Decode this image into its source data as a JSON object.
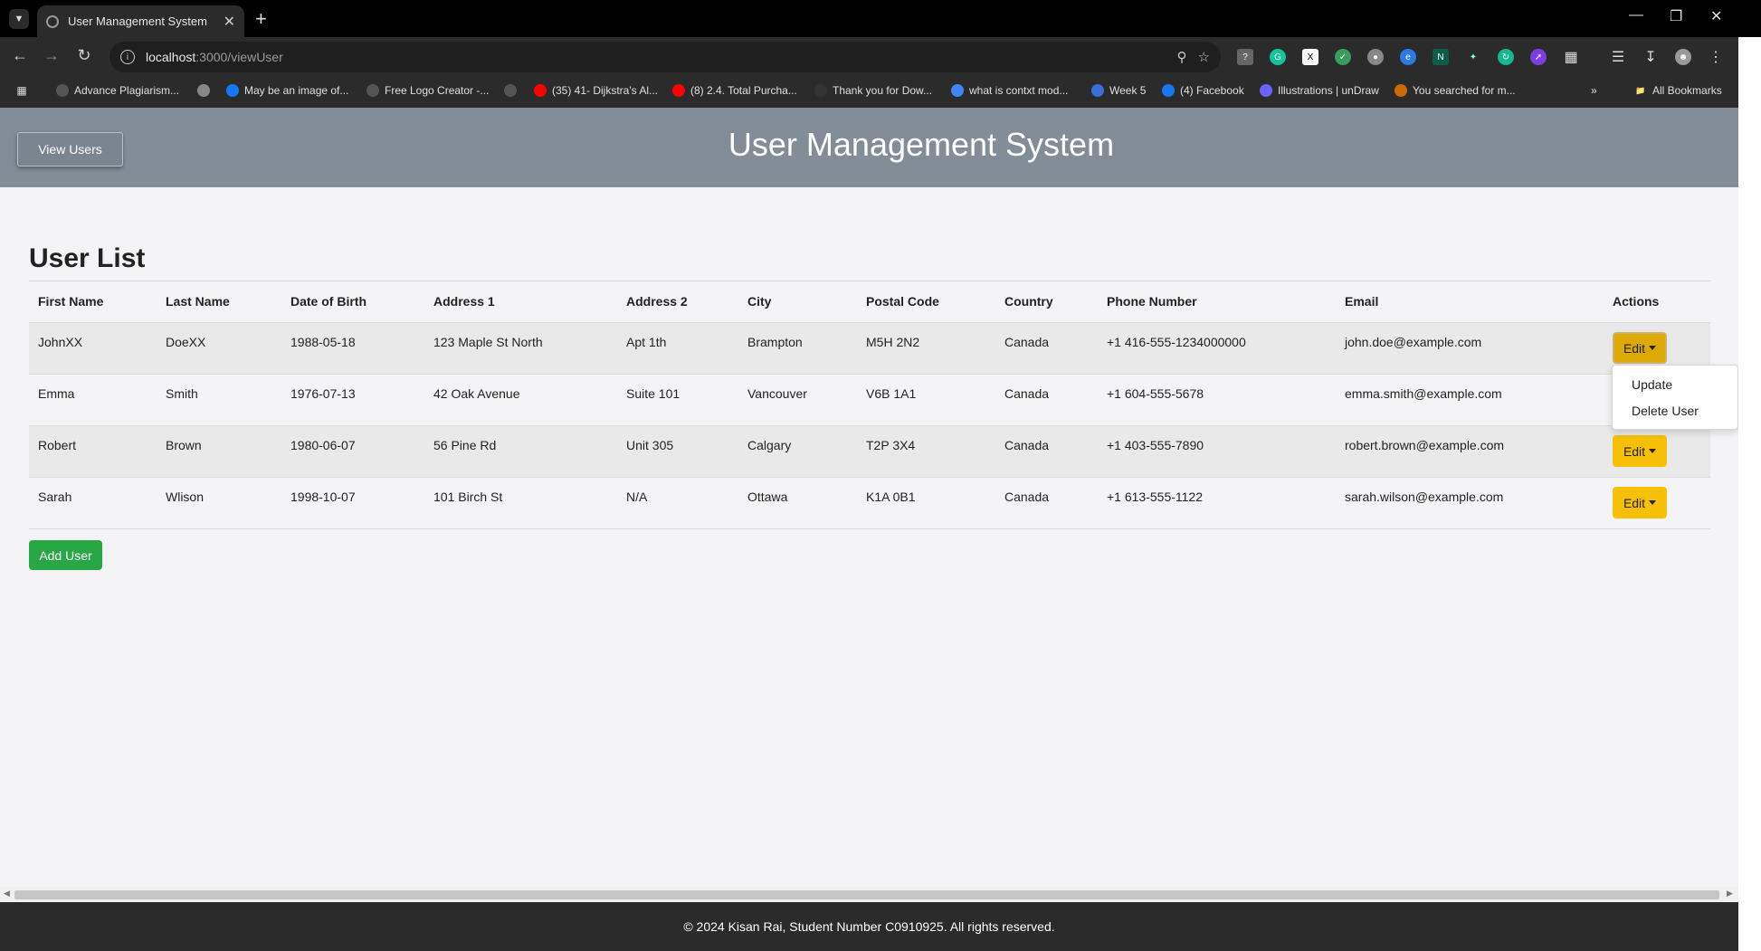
{
  "browser": {
    "tab_title": "User Management System",
    "url_host": "localhost",
    "url_rest": ":3000/viewUser",
    "bookmarks": [
      {
        "label": "Advance Plagiarism...",
        "color": "#555"
      },
      {
        "label": "",
        "color": "#888"
      },
      {
        "label": "May be an image of...",
        "color": "#1877f2"
      },
      {
        "label": "Free Logo Creator -...",
        "color": "#555"
      },
      {
        "label": "",
        "color": "#555"
      },
      {
        "label": "(35) 41- Dijkstra's Al...",
        "color": "#ff0000"
      },
      {
        "label": "(8) 2.4. Total Purcha...",
        "color": "#ff0000"
      },
      {
        "label": "Thank you for Dow...",
        "color": "#333"
      },
      {
        "label": "what is contxt mod...",
        "color": "#4285f4"
      },
      {
        "label": "Week 5",
        "color": "#3b6fd8"
      },
      {
        "label": "(4) Facebook",
        "color": "#1877f2"
      },
      {
        "label": "Illustrations | unDraw",
        "color": "#6c63ff"
      },
      {
        "label": "You searched for m...",
        "color": "#c96a00"
      }
    ],
    "all_bookmarks": "All Bookmarks"
  },
  "header": {
    "view_users_label": "View Users",
    "app_title": "User Management System"
  },
  "main": {
    "list_title": "User List",
    "columns": [
      "First Name",
      "Last Name",
      "Date of Birth",
      "Address 1",
      "Address 2",
      "City",
      "Postal Code",
      "Country",
      "Phone Number",
      "Email",
      "Actions"
    ],
    "rows": [
      [
        "JohnXX",
        "DoeXX",
        "1988-05-18",
        "123 Maple St North",
        "Apt 1th",
        "Brampton",
        "M5H 2N2",
        "Canada",
        "+1 416-555-1234000000",
        "john.doe@example.com"
      ],
      [
        "Emma",
        "Smith",
        "1976-07-13",
        "42 Oak Avenue",
        "Suite 101",
        "Vancouver",
        "V6B 1A1",
        "Canada",
        "+1 604-555-5678",
        "emma.smith@example.com"
      ],
      [
        "Robert",
        "Brown",
        "1980-06-07",
        "56 Pine Rd",
        "Unit 305",
        "Calgary",
        "T2P 3X4",
        "Canada",
        "+1 403-555-7890",
        "robert.brown@example.com"
      ],
      [
        "Sarah",
        "Wlison",
        "1998-10-07",
        "101 Birch St",
        "N/A",
        "Ottawa",
        "K1A 0B1",
        "Canada",
        "+1 613-555-1122",
        "sarah.wilson@example.com"
      ]
    ],
    "edit_label": "Edit",
    "dropdown_items": [
      "Update",
      "Delete User"
    ],
    "add_user_label": "Add User"
  },
  "footer": {
    "text": "© 2024 Kisan Rai, Student Number C0910925. All rights reserved."
  }
}
